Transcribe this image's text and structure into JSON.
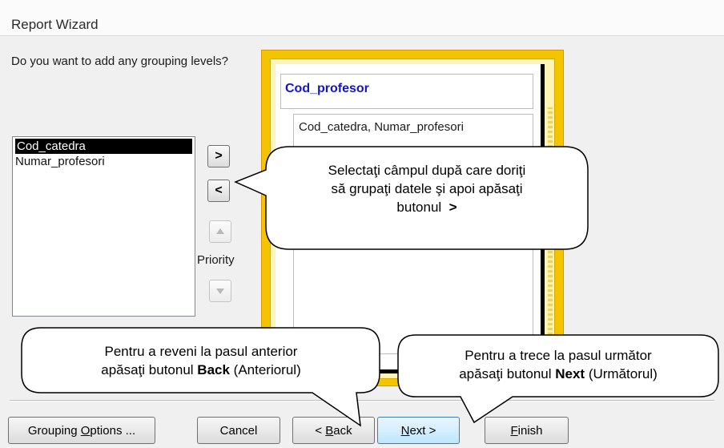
{
  "window": {
    "title": "Report Wizard"
  },
  "question": "Do you want to add any grouping levels?",
  "field_list": {
    "items": [
      "Cod_catedra",
      "Numar_profesori"
    ],
    "selected": "Cod_catedra"
  },
  "move_buttons": {
    "add": ">",
    "remove": "<"
  },
  "priority": {
    "label": "Priority",
    "up_icon": "arrow-up-icon",
    "down_icon": "arrow-down-icon"
  },
  "preview": {
    "header": "Cod_profesor",
    "detail": "Cod_catedra, Numar_profesori"
  },
  "callouts": {
    "select_field": {
      "line1": "Selectaţi câmpul după care doriţi",
      "line2": "să grupaţi datele şi apoi apăsaţi",
      "line3": "butonul",
      "key": ">"
    },
    "back": {
      "line1": "Pentru a reveni la pasul anterior",
      "line2_pre": "apăsaţi butonul ",
      "key": "Back",
      "line2_post": " (Anteriorul)"
    },
    "next": {
      "line1": "Pentru a trece la pasul următor",
      "line2_pre": "apăsaţi butonul ",
      "key": "Next",
      "line2_post": " (Următorul)"
    }
  },
  "buttons": {
    "grouping_options": {
      "text": "Grouping ",
      "ul": "O",
      "rest": "ptions ..."
    },
    "cancel": "Cancel",
    "back": {
      "pre": "< ",
      "ul": "B",
      "rest": "ack"
    },
    "next": {
      "ul": "N",
      "rest": "ext >"
    },
    "finish": {
      "ul": "F",
      "rest": "inish"
    }
  },
  "colors": {
    "preview_heading": "#1414c8",
    "preview_frame": "#f5c400",
    "selection": "#000000",
    "default_button": "#bee6fd"
  }
}
